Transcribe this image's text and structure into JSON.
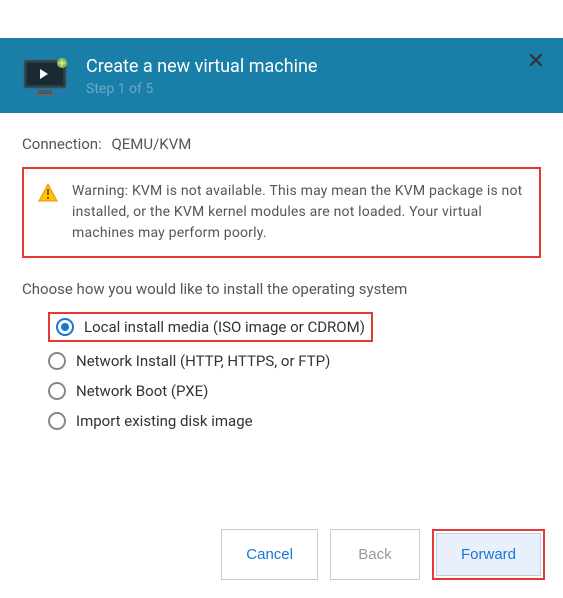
{
  "header": {
    "title": "Create a new virtual machine",
    "step": "Step 1 of 5"
  },
  "connection": {
    "label": "Connection:",
    "value": "QEMU/KVM"
  },
  "warning": {
    "text": "Warning: KVM is not available. This may mean the KVM package is not installed, or the KVM kernel modules are not loaded. Your virtual machines may perform poorly."
  },
  "choose_label": "Choose how you would like to install the operating system",
  "options": {
    "local": "Local install media (ISO image or CDROM)",
    "network_install": "Network Install (HTTP, HTTPS, or FTP)",
    "network_boot": "Network Boot (PXE)",
    "import_disk": "Import existing disk image"
  },
  "buttons": {
    "cancel": "Cancel",
    "back": "Back",
    "forward": "Forward"
  }
}
